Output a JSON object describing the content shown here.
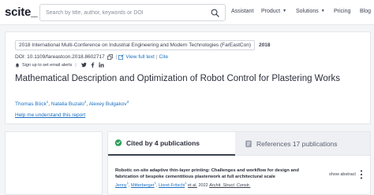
{
  "navbar": {
    "logo": "scite_",
    "search_placeholder": "Search by title, author, keywords or DOI",
    "items": [
      {
        "label": "Assistant",
        "has_caret": false
      },
      {
        "label": "Product",
        "has_caret": true
      },
      {
        "label": "Solutions",
        "has_caret": true
      },
      {
        "label": "Pricing",
        "has_caret": false
      },
      {
        "label": "Blog",
        "has_caret": false
      }
    ],
    "icons": {
      "search": "search-icon",
      "caret": "chevron-down-icon"
    }
  },
  "paper": {
    "venue": "2018 International Multi-Conference on Industrial Engineering and Modern Technologies (FarEastCon)",
    "year": "2018",
    "doi": "DOI: 10.1109/fareastcon.2018.8602717",
    "view_full_text": "View full text",
    "cite": "Cite",
    "alert_text": "Sign up to set email alerts",
    "title": "Mathematical Description and Optimization of Robot Control for Plastering Works",
    "authors": [
      {
        "name": "Thomas Böck",
        "sup": "1"
      },
      {
        "name": "Natalia Buzalo",
        "sup": "2"
      },
      {
        "name": "Alexey Bulgakov",
        "sup": "3"
      }
    ],
    "help_link": "Help me understand this report",
    "icons": [
      "copy-icon",
      "bell-icon",
      "twitter-icon",
      "facebook-icon",
      "linkedin-icon"
    ]
  },
  "tabs": {
    "cited_by": "Cited by 4 publications",
    "references": "References 17 publications"
  },
  "citing": {
    "title": "Robotic on-site adaptive thin-layer printing: Challenges and workflow for design and fabrication of bespoke cementitious plasterwork at full architectural scale",
    "authors": [
      "Jenny",
      "Mitterberger",
      "Lloret-Fritschi"
    ],
    "et_al": "et al.",
    "year": "2022",
    "journal": "Archit. Struct. Constr.",
    "show_abstract": "show abstract"
  },
  "colors": {
    "link": "#1a6fc1",
    "text": "#3c4150",
    "background": "#f4f5f7",
    "tab_active_icon": "#2e9e5b"
  }
}
